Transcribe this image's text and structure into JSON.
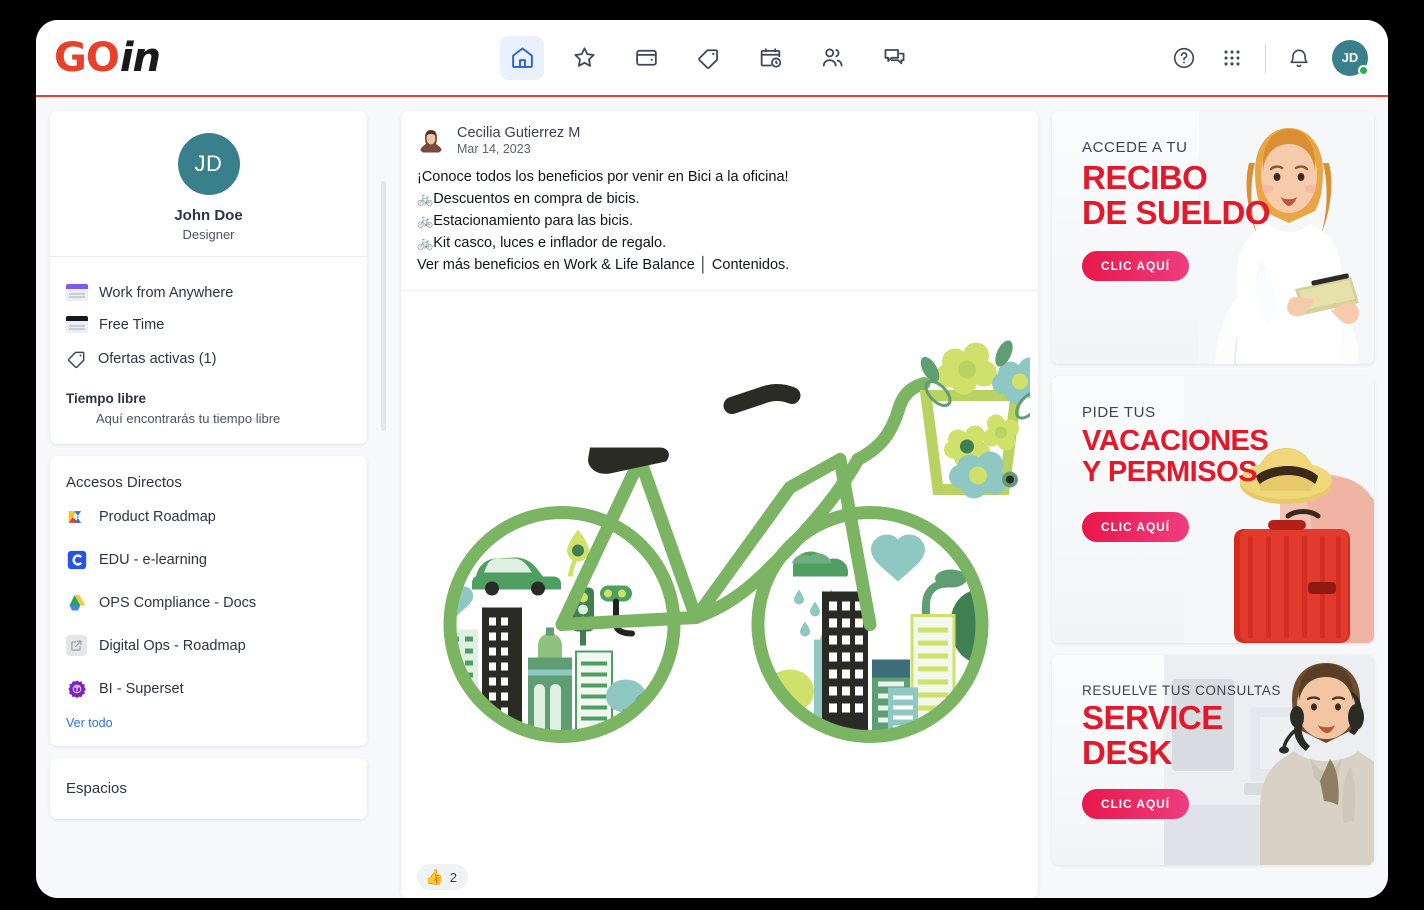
{
  "brand": {
    "logo_go": "GO",
    "logo_in": "in",
    "accent_red": "#e8402a",
    "accent_blue": "#2f6fe0",
    "teal": "#3a7f8c"
  },
  "header": {
    "nav": [
      {
        "name": "home",
        "label": "Inicio",
        "active": true
      },
      {
        "name": "star",
        "label": "Favoritos",
        "active": false
      },
      {
        "name": "wallet",
        "label": "Billetera",
        "active": false
      },
      {
        "name": "tag",
        "label": "Ofertas",
        "active": false
      },
      {
        "name": "calendar-clock",
        "label": "Calendario",
        "active": false
      },
      {
        "name": "users",
        "label": "Personas",
        "active": false
      },
      {
        "name": "chat",
        "label": "Mensajes",
        "active": false
      }
    ],
    "help_label": "Ayuda",
    "apps_label": "Aplicaciones",
    "bell_label": "Notificaciones",
    "avatar_initials": "JD",
    "status": "online"
  },
  "sidebar": {
    "profile": {
      "initials": "JD",
      "name": "John Doe",
      "role": "Designer"
    },
    "status_items": [
      {
        "label": "Work from Anywhere",
        "icon": "card-purple-icon"
      },
      {
        "label": "Free Time",
        "icon": "card-dark-icon"
      },
      {
        "label": "Ofertas activas (1)",
        "icon": "tag-icon"
      }
    ],
    "free_time_heading": "Tiempo libre",
    "free_time_text": "Aquí encontrarás tu tiempo libre",
    "shortcuts_title": "Accesos Directos",
    "shortcuts": [
      {
        "label": "Product Roadmap",
        "icon": "miro-icon"
      },
      {
        "label": "EDU - e-learning",
        "icon": "coursera-icon"
      },
      {
        "label": "OPS Compliance - Docs",
        "icon": "google-drive-icon"
      },
      {
        "label": "Digital Ops - Roadmap",
        "icon": "external-link-icon"
      },
      {
        "label": "BI - Superset",
        "icon": "superset-icon"
      }
    ],
    "see_all": "Ver todo",
    "spaces_title": "Espacios"
  },
  "feed": {
    "post": {
      "author": "Cecilia Gutierrez M",
      "date": "Mar 14, 2023",
      "lines": [
        {
          "bullet": "",
          "text": "¡Conoce todos los beneficios por venir en Bici a la oficina!"
        },
        {
          "bullet": "🚲",
          "text": "Descuentos en compra de bicis."
        },
        {
          "bullet": "🚲",
          "text": "Estacionamiento para las bicis."
        },
        {
          "bullet": "🚲",
          "text": "Kit casco, luces e inflador de regalo."
        },
        {
          "bullet": "",
          "text": "Ver más beneficios en Work & Life Balance │ Contenidos."
        }
      ],
      "image_alt": "eco-bicycle-illustration",
      "reaction_emoji": "👍",
      "reaction_count": "2"
    }
  },
  "banners": [
    {
      "kicker": "ACCEDE A TU",
      "title_line1": "RECIBO",
      "title_line2": "DE SUELDO",
      "cta": "CLIC AQUÍ",
      "art": "woman-with-tablet"
    },
    {
      "kicker": "PIDE TUS",
      "title_line1": "VACACIONES",
      "title_line2": "Y PERMISOS",
      "cta": "CLIC AQUÍ",
      "art": "red-suitcase-straw-hat"
    },
    {
      "kicker": "RESUELVE TUS CONSULTAS",
      "title_line1": "SERVICE",
      "title_line2": "DESK",
      "cta": "CLIC AQUÍ",
      "art": "support-agent-headset"
    }
  ]
}
